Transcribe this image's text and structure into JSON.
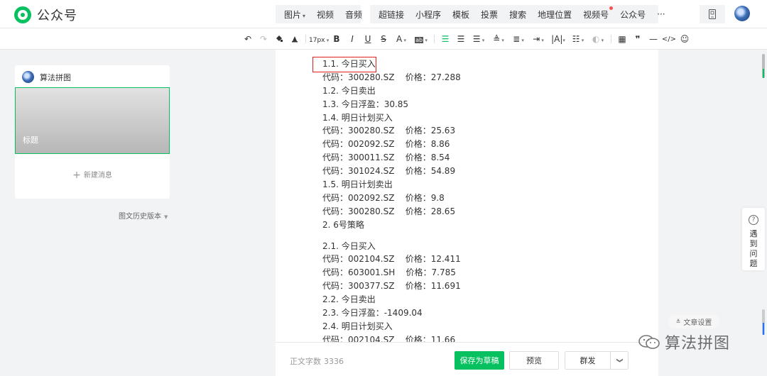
{
  "header": {
    "logo_text": "公众号",
    "menu_group1": [
      {
        "label": "图片",
        "caret": "▾"
      },
      {
        "label": "视频"
      },
      {
        "label": "音频"
      }
    ],
    "menu_group2": [
      {
        "label": "超链接"
      },
      {
        "label": "小程序"
      },
      {
        "label": "模板"
      },
      {
        "label": "投票"
      },
      {
        "label": "搜索"
      },
      {
        "label": "地理位置"
      },
      {
        "label": "视频号",
        "has_red_dot": true
      },
      {
        "label": "公众号"
      },
      {
        "label": "···"
      }
    ]
  },
  "toolbar": {
    "font_size": "17px",
    "bold": "B",
    "italic": "I",
    "underline": "U",
    "strikethrough": "S",
    "font_color": "A",
    "highlight": "ab",
    "quote_icon": "❞"
  },
  "sidebar": {
    "account_name": "算法拼图",
    "article_title": "标题",
    "new_message": "新建消息",
    "history_label": "图文历史版本"
  },
  "editor": {
    "lines": [
      "1.1. 今日买入",
      "代码：300280.SZ    价格：27.288",
      "1.2. 今日卖出",
      "1.3. 今日浮盈：30.85",
      "1.4. 明日计划买入",
      "代码：300280.SZ    价格：25.63",
      "代码：002092.SZ    价格：8.86",
      "代码：300011.SZ    价格：8.54",
      "代码：301024.SZ    价格：54.89",
      "1.5. 明日计划卖出",
      "代码：002092.SZ    价格：9.8",
      "代码：300280.SZ    价格：28.65",
      "2. 6号策略",
      "",
      "2.1. 今日买入",
      "代码：002104.SZ    价格：12.411",
      "代码：603001.SH    价格：7.785",
      "代码：300377.SZ    价格：11.691",
      "2.2. 今日卖出",
      "2.3. 今日浮盈：-1409.04",
      "2.4. 明日计划买入",
      "代码：002104.SZ    价格：11.66"
    ]
  },
  "bottom": {
    "wordcount_label": "正文字数",
    "wordcount_value": "3336",
    "save_draft": "保存为草稿",
    "preview": "预览",
    "mass_send": "群发",
    "mass_caret": "❯"
  },
  "right": {
    "help_text": "遇到问题",
    "help_icon_char": "?",
    "article_settings": "文章设置"
  },
  "watermark": {
    "text": "算法拼图"
  },
  "colors": {
    "brand_green": "#07c160",
    "highlight_red": "#e02020",
    "red_dot": "#fa5151"
  }
}
